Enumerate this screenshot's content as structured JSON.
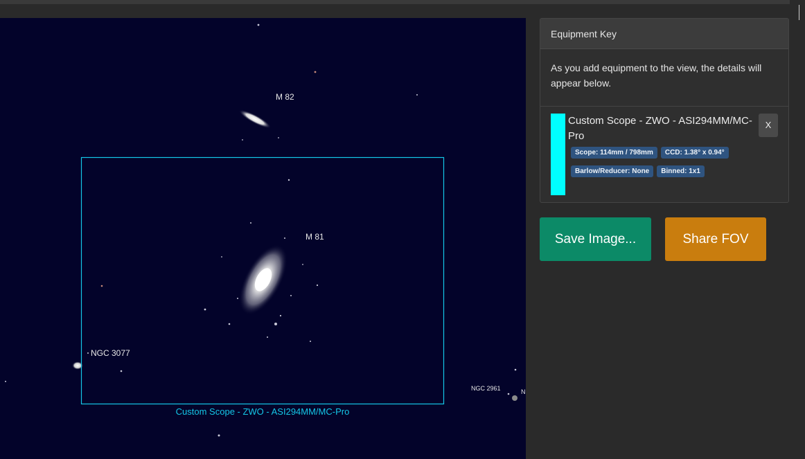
{
  "sky_view": {
    "object_labels": {
      "m82": "M 82",
      "m81": "M 81",
      "ngc3077": "NGC 3077",
      "ngc2961": "NGC 2961",
      "ngc_partial": "N"
    },
    "fov_caption": "Custom Scope - ZWO - ASI294MM/MC-Pro",
    "fov_color": "#14c8e8",
    "background_color": "#03032a"
  },
  "equipment_panel": {
    "title": "Equipment Key",
    "intro": "As you add equipment to the view, the details will appear below.",
    "items": [
      {
        "name": "Custom Scope - ZWO - ASI294MM/MC-Pro",
        "color": "#00ffff",
        "badges": [
          "Scope: 114mm / 798mm",
          "CCD: 1.38° x 0.94°",
          "Barlow/Reducer: None",
          "Binned: 1x1"
        ],
        "remove_label": "X"
      }
    ]
  },
  "actions": {
    "save_label": "Save Image...",
    "share_label": "Share FOV"
  }
}
